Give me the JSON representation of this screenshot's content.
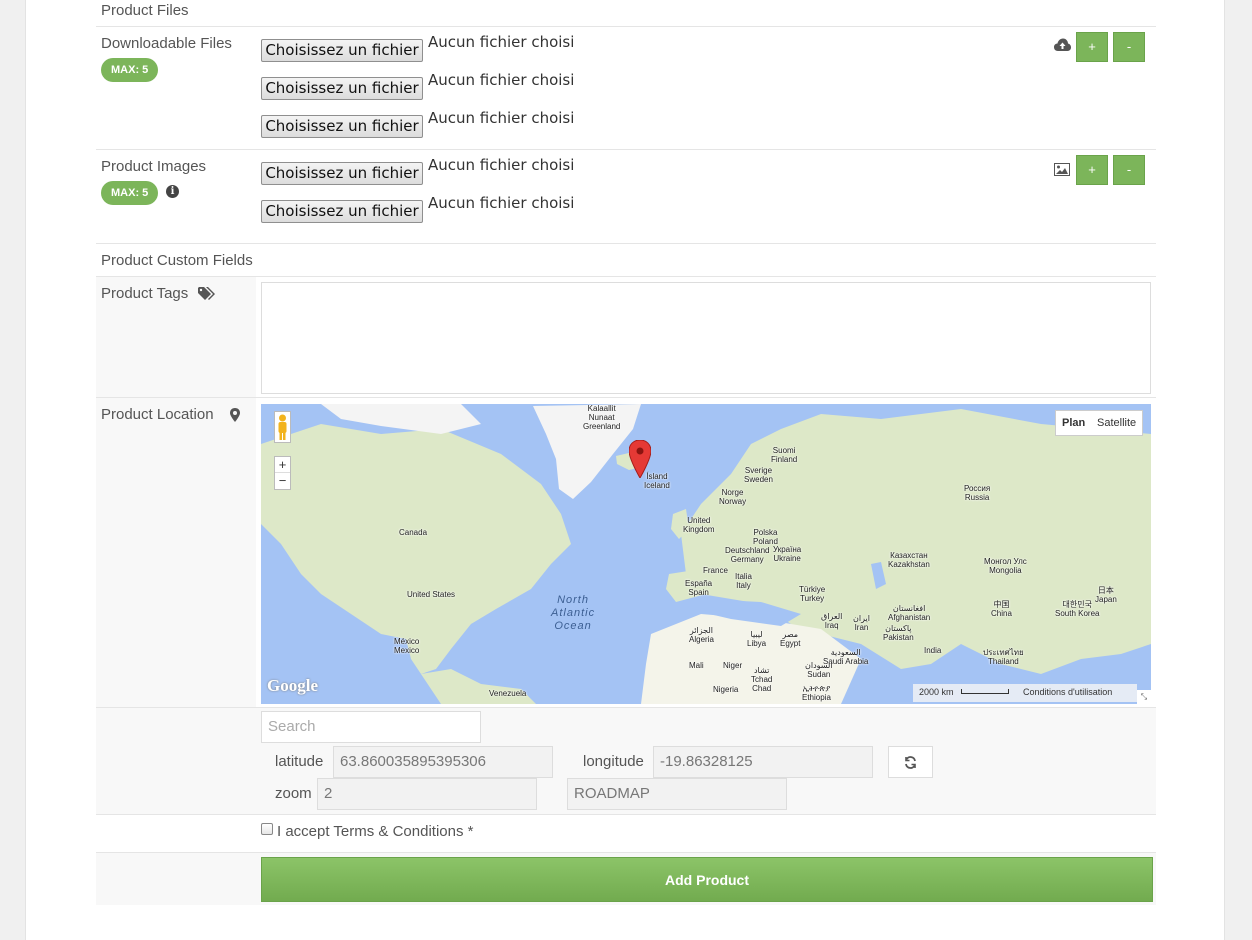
{
  "product_files": {
    "title": "Product Files",
    "downloadable": {
      "label": "Downloadable Files",
      "badge": "MAX: 5",
      "rows": [
        {
          "button": "Choisissez un fichier",
          "status": "Aucun fichier choisi"
        },
        {
          "button": "Choisissez un fichier",
          "status": "Aucun fichier choisi"
        },
        {
          "button": "Choisissez un fichier",
          "status": "Aucun fichier choisi"
        }
      ],
      "add": "+",
      "remove": "-",
      "icon": "cloud-upload-icon"
    },
    "images": {
      "label": "Product Images",
      "badge": "MAX: 5",
      "info": "i",
      "rows": [
        {
          "button": "Choisissez un fichier",
          "status": "Aucun fichier choisi"
        },
        {
          "button": "Choisissez un fichier",
          "status": "Aucun fichier choisi"
        }
      ],
      "add": "+",
      "remove": "-",
      "icon": "image-icon"
    }
  },
  "custom_fields": {
    "title": "Product Custom Fields",
    "tags_label": "Product Tags",
    "location_label": "Product Location"
  },
  "map": {
    "type_plan": "Plan",
    "type_satellite": "Satellite",
    "zoom_in": "+",
    "zoom_out": "−",
    "logo": "Google",
    "scale": "2000 km",
    "terms": "Conditions d'utilisation",
    "marker": {
      "lat": 63.86,
      "lng": -19.86
    },
    "labels": [
      {
        "text": "Kalaallit\nNunaat\nGreenland"
      },
      {
        "text": "Ísland\nIceland"
      },
      {
        "text": "Suomi\nFinland"
      },
      {
        "text": "Sverige\nSweden"
      },
      {
        "text": "Norge\nNorway"
      },
      {
        "text": "Россия\nRussia"
      },
      {
        "text": "Canada"
      },
      {
        "text": "United\nKingdom"
      },
      {
        "text": "Polska\nPoland"
      },
      {
        "text": "Deutschland\nGermany"
      },
      {
        "text": "Україна\nUkraine"
      },
      {
        "text": "France"
      },
      {
        "text": "Italia\nItaly"
      },
      {
        "text": "Казахстан\nKazakhstan"
      },
      {
        "text": "Монгол Улс\nMongolia"
      },
      {
        "text": "España\nSpain"
      },
      {
        "text": "Türkiye\nTurkey"
      },
      {
        "text": "United States"
      },
      {
        "text": "中国\nChina"
      },
      {
        "text": "日本\nJapan"
      },
      {
        "text": "대한민국\nSouth Korea"
      },
      {
        "text": "افغانستان\nAfghanistan"
      },
      {
        "text": "العراق\nIraq"
      },
      {
        "text": "ایران\nIran"
      },
      {
        "text": "پاکستان\nPakistan"
      },
      {
        "text": "الجزائر\nAlgeria"
      },
      {
        "text": "ليبيا\nLibya"
      },
      {
        "text": "مصر\nEgypt"
      },
      {
        "text": "México\nMexico"
      },
      {
        "text": "السعودية\nSaudi Arabia"
      },
      {
        "text": "India"
      },
      {
        "text": "ประเทศไทย\nThailand"
      },
      {
        "text": "Mali"
      },
      {
        "text": "Niger"
      },
      {
        "text": "تشاد\nTchad\nChad"
      },
      {
        "text": "السودان\nSudan"
      },
      {
        "text": "Nigeria"
      },
      {
        "text": "ኢትዮጵያ\nEthiopia"
      },
      {
        "text": "Venezuela"
      }
    ],
    "ocean": "North\nAtlantic\nOcean"
  },
  "search": {
    "placeholder": "Search"
  },
  "coords": {
    "latitude_label": "latitude",
    "latitude": "63.860035895395306",
    "longitude_label": "longitude",
    "longitude": "-19.86328125",
    "zoom_label": "zoom",
    "zoom": "2",
    "maptype": "ROADMAP",
    "refresh_icon": "refresh-icon"
  },
  "terms": {
    "label": "I accept Terms & Conditions *"
  },
  "submit": {
    "label": "Add Product"
  },
  "colors": {
    "accent": "#7cb55a",
    "water": "#a4c3f4",
    "land": "#dde8c8"
  }
}
